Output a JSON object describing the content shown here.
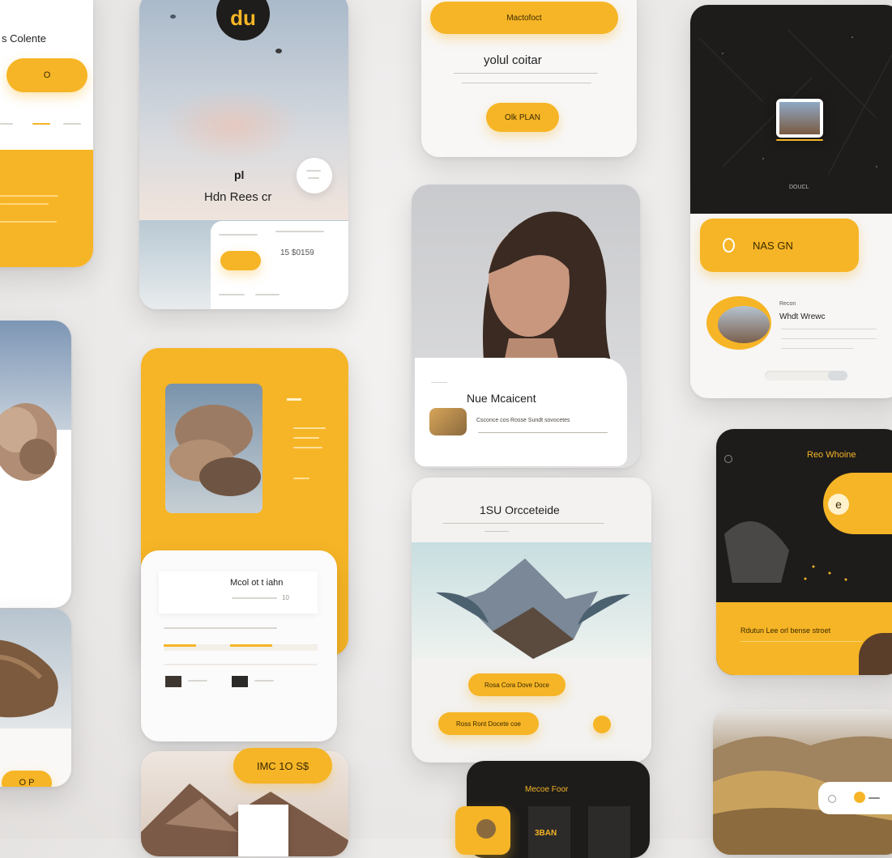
{
  "col1": {
    "header_title": "s Colente",
    "pill_label": "O ",
    "bottom_pill_label": "O P"
  },
  "col2": {
    "logo_text": "du",
    "mark_text": "pl",
    "hero_title": "Hdn Rees cr",
    "circle_line1": "",
    "price_text": "15 $0159",
    "small_pill_label": "",
    "card_heading": "Mcol ot t iahn",
    "card_price": "10",
    "bottom_pill_label": "IMC 1O S$"
  },
  "col3": {
    "top_button_label": "Mactofoct",
    "title": "yolul coitar",
    "cta_label": "Olk PLAN",
    "profile_title": "Nue Mcaicent",
    "profile_line": "Csconce cos Rosse Sundt sovocetes",
    "section_title": "1SU Orcceteide",
    "pill_one_label": "Rosa Cora Dove Doce",
    "pill_two_label": "Ross Ront Docete coe",
    "dark_title": "Mecoe Foor",
    "dark_badge": "3BAN"
  },
  "col4": {
    "dark_caption": "DOUCL",
    "pill_label": "NAS GN",
    "feature_small": "Recon",
    "feature_title": "Whdt Wrewc",
    "dark2_title": "Reo Whoine",
    "dark2_headline": "Rdutun Lee orl bense stroet",
    "circle_glyph": "e"
  },
  "colors": {
    "accent": "#f6b526",
    "dark": "#1d1c1b",
    "panel": "#ffffff",
    "text": "#222222"
  }
}
